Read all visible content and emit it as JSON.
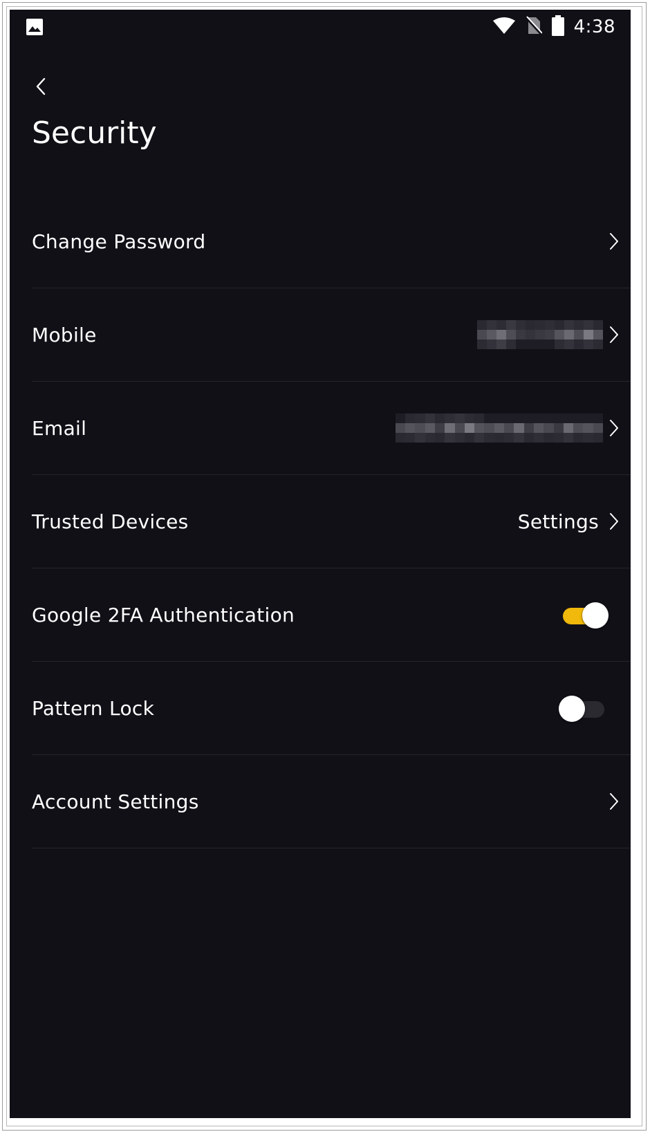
{
  "colors": {
    "background": "#121017",
    "text": "#ffffff",
    "accent": "#F0B90B",
    "divider": "#26242c",
    "toggle_off_track": "#2b2a31"
  },
  "status_bar": {
    "left_icon": "image-icon",
    "icons": [
      "wifi-icon",
      "no-sim-icon",
      "battery-icon"
    ],
    "time": "4:38"
  },
  "header": {
    "back_icon": "chevron-left-icon",
    "title": "Security"
  },
  "settings": [
    {
      "label": "Change Password",
      "value": "",
      "control": "chevron"
    },
    {
      "label": "Mobile",
      "value": "[redacted]",
      "control": "chevron"
    },
    {
      "label": "Email",
      "value": "[redacted]",
      "control": "chevron"
    },
    {
      "label": "Trusted Devices",
      "value": "Settings",
      "control": "chevron"
    },
    {
      "label": "Google 2FA Authentication",
      "control": "toggle",
      "enabled": true
    },
    {
      "label": "Pattern Lock",
      "control": "toggle",
      "enabled": false
    },
    {
      "label": "Account Settings",
      "value": "",
      "control": "chevron"
    }
  ]
}
